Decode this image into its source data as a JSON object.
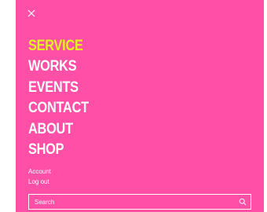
{
  "colors": {
    "background": "#ff4fa7",
    "active_item": "#e1f21e",
    "text": "#ffffff"
  },
  "close_icon": "close-icon",
  "menu": {
    "items": [
      {
        "label": "SERVICE",
        "active": true
      },
      {
        "label": "WORKS",
        "active": false
      },
      {
        "label": "EVENTS",
        "active": false
      },
      {
        "label": "CONTACT",
        "active": false
      },
      {
        "label": "ABOUT",
        "active": false
      },
      {
        "label": "SHOP",
        "active": false
      }
    ]
  },
  "account": {
    "account_label": "Account",
    "logout_label": "Log out"
  },
  "search": {
    "placeholder": "Search",
    "value": "",
    "icon": "search-icon"
  }
}
